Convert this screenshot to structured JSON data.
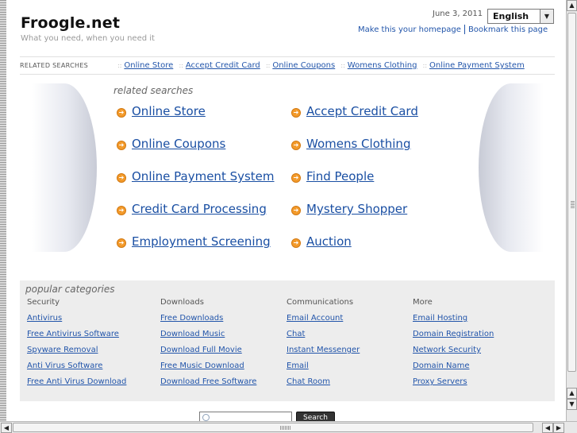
{
  "header": {
    "site_name": "Froogle.net",
    "tagline": "What you need, when you need it",
    "date": "June 3, 2011",
    "language": "English",
    "make_homepage": "Make this your homepage",
    "bookmark": "Bookmark this page"
  },
  "related_bar": {
    "label": "RELATED SEARCHES",
    "links": [
      "Online Store",
      "Accept Credit Card",
      "Online Coupons",
      "Womens Clothing",
      "Online Payment System"
    ]
  },
  "related_searches": {
    "heading": "related searches",
    "items": [
      "Online Store",
      "Accept Credit Card",
      "Online Coupons",
      "Womens Clothing",
      "Online Payment System",
      "Find People",
      "Credit Card Processing",
      "Mystery Shopper",
      "Employment Screening",
      "Auction"
    ]
  },
  "popular": {
    "heading": "popular categories",
    "columns": [
      {
        "title": "Security",
        "links": [
          "Antivirus",
          "Free Antivirus Software",
          "Spyware Removal",
          "Anti Virus Software",
          "Free Anti Virus Download"
        ]
      },
      {
        "title": "Downloads",
        "links": [
          "Free Downloads",
          "Download Music",
          "Download Full Movie",
          "Free Music Download",
          "Download Free Software"
        ]
      },
      {
        "title": "Communications",
        "links": [
          "Email Account",
          "Chat",
          "Instant Messenger",
          "Email",
          "Chat Room"
        ]
      },
      {
        "title": "More",
        "links": [
          "Email Hosting",
          "Domain Registration",
          "Network Security",
          "Domain Name",
          "Proxy Servers"
        ]
      }
    ]
  },
  "search": {
    "button_label": "Search"
  },
  "icons": {
    "bullet": "arrow-circle-right-icon",
    "search": "magnifier-icon",
    "dropdown": "chevron-down-icon"
  },
  "colors": {
    "link": "#1a4fa3",
    "bullet": "#f39a2a",
    "panel": "#ededed"
  }
}
